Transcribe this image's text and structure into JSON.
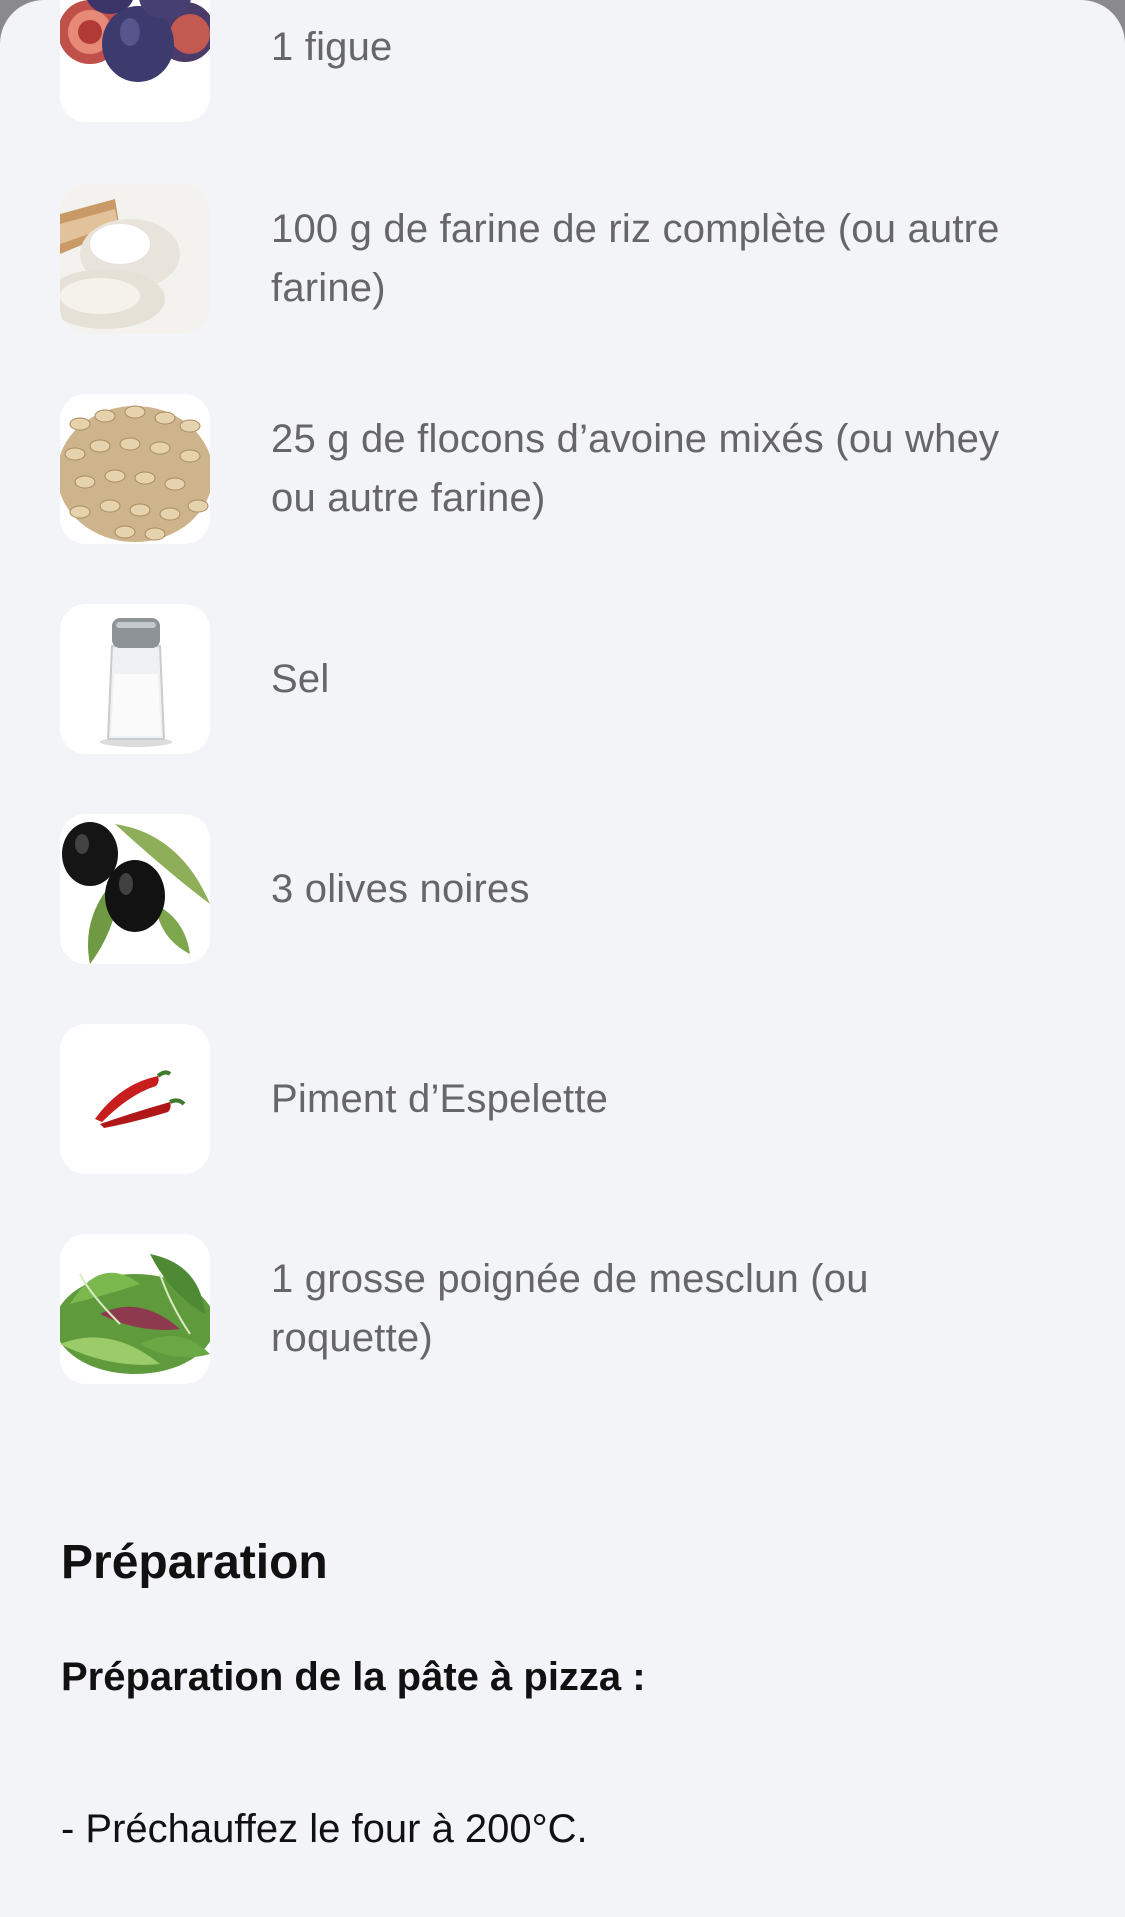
{
  "ingredients": [
    {
      "text": "1 figue",
      "icon": "fig-icon"
    },
    {
      "text": "100 g de farine de riz complète (ou autre farine)",
      "icon": "flour-icon"
    },
    {
      "text": "25 g de flocons d’avoine mixés (ou whey ou autre farine)",
      "icon": "oats-icon"
    },
    {
      "text": "Sel",
      "icon": "salt-shaker-icon"
    },
    {
      "text": "3 olives noires",
      "icon": "olives-icon"
    },
    {
      "text": "Piment d’Espelette",
      "icon": "chili-pepper-icon"
    },
    {
      "text": "1 grosse poignée de mesclun (ou roquette)",
      "icon": "salad-greens-icon"
    }
  ],
  "preparation": {
    "title": "Préparation",
    "subtitle": "Préparation de la pâte à pizza :",
    "steps": [
      "- Préchauffez le four à 200°C."
    ]
  }
}
